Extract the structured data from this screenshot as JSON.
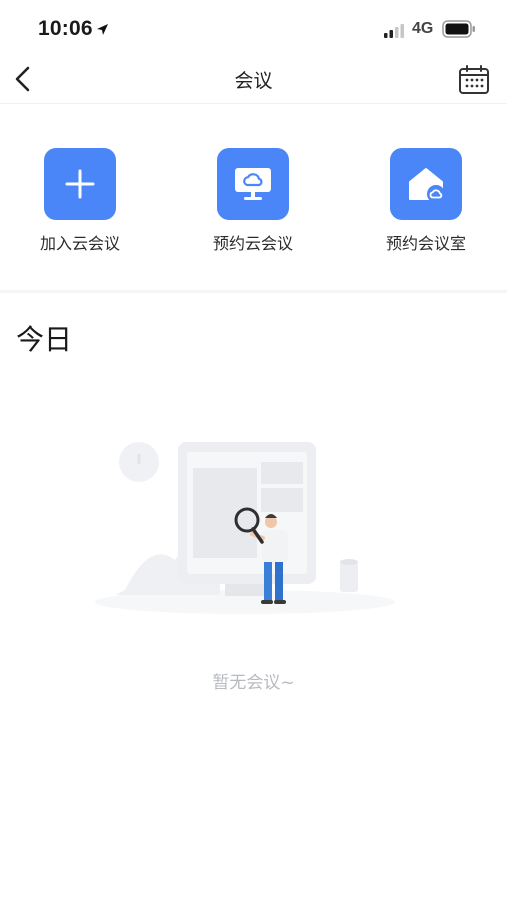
{
  "status_bar": {
    "time": "10:06",
    "network": "4G"
  },
  "nav": {
    "title": "会议"
  },
  "actions": [
    {
      "label": "加入云会议",
      "icon": "plus-icon"
    },
    {
      "label": "预约云会议",
      "icon": "monitor-cloud-icon"
    },
    {
      "label": "预约会议室",
      "icon": "home-cloud-icon"
    }
  ],
  "section": {
    "title": "今日"
  },
  "empty_state": {
    "message": "暂无会议~"
  },
  "colors": {
    "accent": "#4a86f7",
    "empty_text": "#b7bac0"
  }
}
